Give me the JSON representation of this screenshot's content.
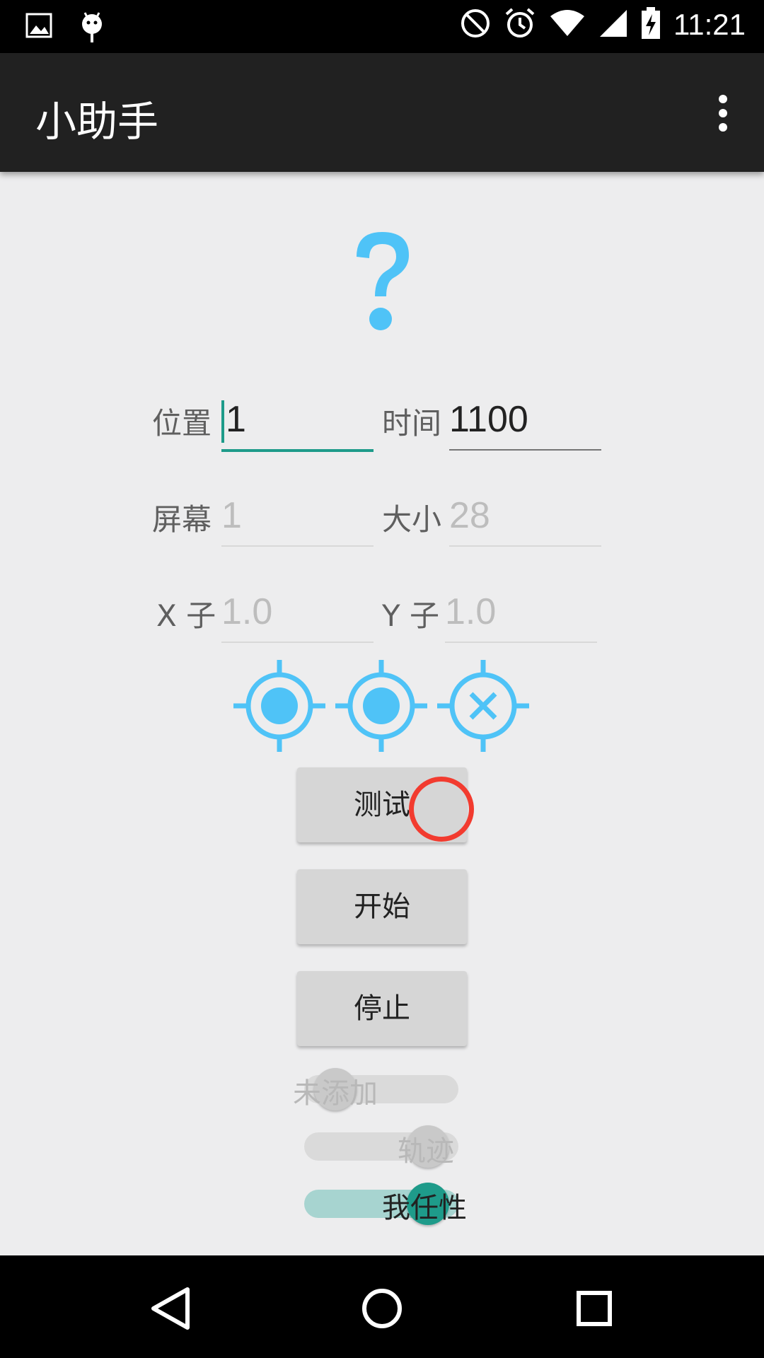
{
  "status_bar": {
    "time": "11:21",
    "left_icons": [
      "image-icon",
      "android-debug-icon"
    ],
    "right_icons": [
      "do-not-disturb-icon",
      "alarm-icon",
      "wifi-icon",
      "signal-icon",
      "battery-charging-icon"
    ]
  },
  "app_bar": {
    "title": "小助手",
    "menu_icon": "overflow-menu-icon"
  },
  "hero_icon": "question-mark-icon",
  "colors": {
    "accent": "#1e9b8a",
    "icon_blue": "#4fc3f7",
    "touch_indicator": "#f23b2f",
    "app_bar": "#212121",
    "background": "#ededee"
  },
  "form": {
    "position_label": "位置",
    "position_value": "1",
    "time_label": "时间",
    "time_value": "1100",
    "screen_label": "屏幕",
    "screen_placeholder": "1",
    "size_label": "大小",
    "size_placeholder": "28",
    "x_label": "X 子",
    "x_placeholder": "1.0",
    "y_label": "Y 子",
    "y_placeholder": "1.0"
  },
  "targets": [
    "target-dot-icon",
    "target-dot-icon",
    "target-cross-icon"
  ],
  "buttons": {
    "test": "测试",
    "start": "开始",
    "stop": "停止"
  },
  "toggles": [
    {
      "label": "未添加",
      "state": "off"
    },
    {
      "label": "轨迹",
      "state": "off"
    },
    {
      "label": "我任性",
      "state": "on"
    }
  ],
  "nav": [
    "back-icon",
    "home-icon",
    "recents-icon"
  ]
}
